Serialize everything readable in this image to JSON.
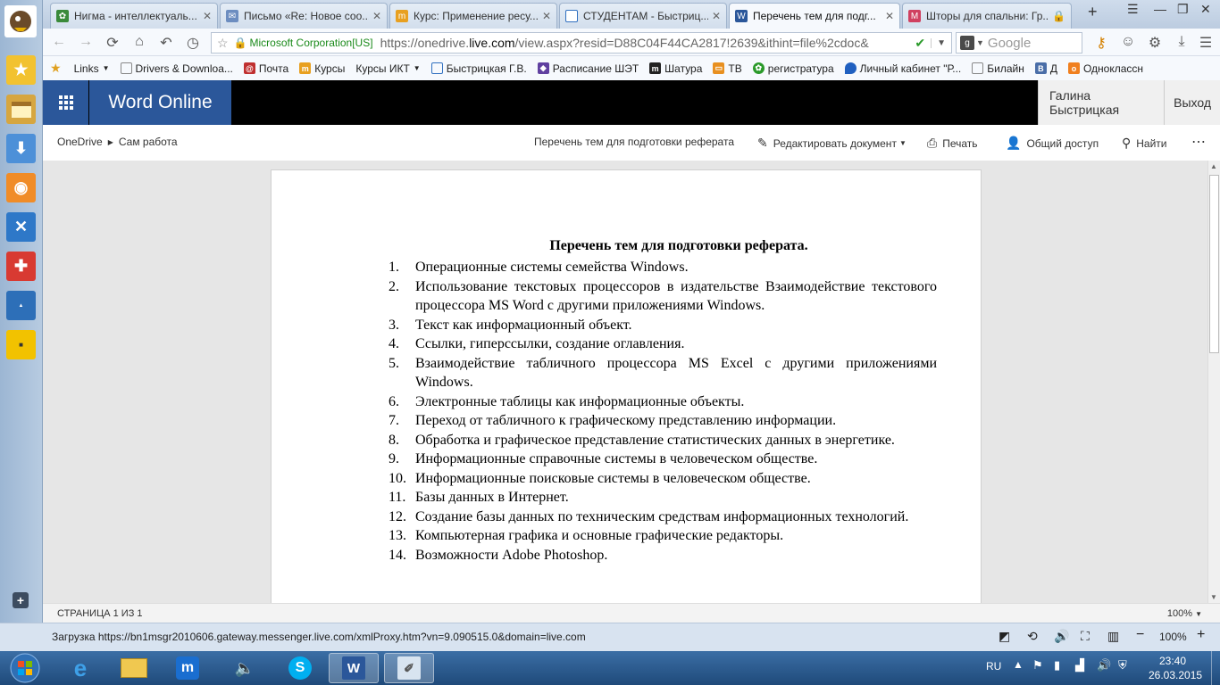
{
  "tabs": [
    {
      "label": "Нигма - интеллектуаль..."
    },
    {
      "label": "Письмо «Re: Новое соо..."
    },
    {
      "label": "Курс: Применение ресу..."
    },
    {
      "label": "СТУДЕНТАМ - Быстриц..."
    },
    {
      "label": "Перечень тем для подг..."
    },
    {
      "label": "Шторы для спальни: Гр..."
    }
  ],
  "nav": {
    "cert": "Microsoft Corporation[US]",
    "url_prefix": "https://onedrive.",
    "url_host": "live.com",
    "url_rest": "/view.aspx?resid=D88C04F44CA2817!2639&ithint=file%2cdoc&",
    "search_placeholder": "Google"
  },
  "bookmarks": [
    "Links",
    "Drivers & Downloa...",
    "Почта",
    "Курсы",
    "Курсы ИКТ",
    "Быстрицкая Г.В.",
    "Расписание ШЭТ",
    "Шатура",
    "ТВ",
    "регистратура",
    "Личный кабинет \"Р...",
    "Билайн",
    "Д",
    "Одноклассн"
  ],
  "header": {
    "app_name": "Word Online",
    "user": "Галина Быстрицкая",
    "logout": "Выход"
  },
  "breadcrumb": {
    "root": "OneDrive",
    "folder": "Сам работа"
  },
  "commands": {
    "doc_title": "Перечень тем для подготовки реферата",
    "edit": "Редактировать документ",
    "print": "Печать",
    "share": "Общий доступ",
    "find": "Найти"
  },
  "document": {
    "title": "Перечень тем для подготовки реферата.",
    "items": [
      {
        "num": "1.",
        "text": "Операционные системы семейства Windows."
      },
      {
        "num": "2.",
        "text": "Использование текстовых процессоров в издательстве Взаимодействие текстового процессора MS Word с другими приложениями Windows."
      },
      {
        "num": "3.",
        "text": "Текст как информационный объект."
      },
      {
        "num": "4.",
        "text": "Ссылки, гиперссылки, создание оглавления."
      },
      {
        "num": "5.",
        "text": "Взаимодействие табличного процессора MS Excel с другими приложениями Windows."
      },
      {
        "num": "6.",
        "text": "Электронные таблицы как информационные объекты."
      },
      {
        "num": "7.",
        "text": "Переход от табличного к графическому представлению информации."
      },
      {
        "num": "8.",
        "text": "Обработка и графическое представление статистических данных в энергетике."
      },
      {
        "num": "9.",
        "text": "Информационные справочные системы в человеческом обществе."
      },
      {
        "num": "10.",
        "text": "Информационные поисковые системы в человеческом обществе."
      },
      {
        "num": "11.",
        "text": "Базы данных в Интернет."
      },
      {
        "num": "12.",
        "text": "Создание базы данных по техническим средствам информационных технологий."
      },
      {
        "num": "13.",
        "text": "Компьютерная графика и основные графические редакторы."
      },
      {
        "num": "14.",
        "text": "Возможности Adobe Photoshop."
      }
    ]
  },
  "word_status": {
    "page": "СТРАНИЦА 1 ИЗ 1",
    "zoom": "100%"
  },
  "browser_status": {
    "loading": "Загрузка https://bn1msgr2010606.gateway.messenger.live.com/xmlProxy.htm?vn=9.090515.0&domain=live.com",
    "zoom": "100%"
  },
  "tray": {
    "lang": "RU",
    "time": "23:40",
    "date": "26.03.2015"
  },
  "colors": {
    "word_blue": "#2b579a",
    "taskbar": "#2a5a8f"
  }
}
